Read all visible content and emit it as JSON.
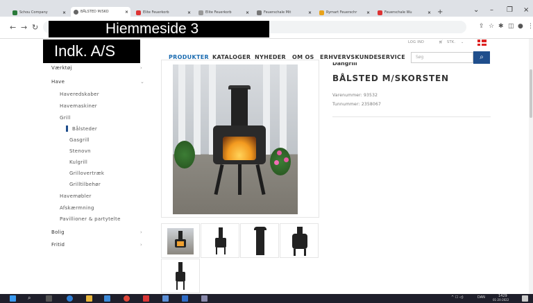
{
  "browser": {
    "tabs": [
      {
        "title": "Schou Company",
        "color": "#2a7a3a",
        "active": false
      },
      {
        "title": "BÅLSTED M/SKO",
        "color": "#666",
        "active": true
      },
      {
        "title": "Elite Feuerkorb",
        "color": "#d33",
        "active": false
      },
      {
        "title": "Elite Feuerkorb",
        "color": "#999",
        "active": false
      },
      {
        "title": "Feuerschale Mit",
        "color": "#777",
        "active": false
      },
      {
        "title": "Rymart Feuerschr",
        "color": "#e8a21a",
        "active": false
      },
      {
        "title": "Feuerschale Wu",
        "color": "#d33",
        "active": false
      }
    ],
    "url_redacted_text": "Hiemmeside 3",
    "nav": {
      "back": "←",
      "forward": "→",
      "reload": "↻"
    }
  },
  "site": {
    "logo_redacted_text": "Indk. A/S",
    "top_links": {
      "login": "LOG IND",
      "cart": "STK."
    },
    "nav": [
      {
        "label": "PRODUKTER",
        "active": true
      },
      {
        "label": "KATALOGER",
        "active": false
      },
      {
        "label": "NYHEDER",
        "active": false
      },
      {
        "label": "OM OS",
        "active": false
      },
      {
        "label": "ERHVERVSKUNDE",
        "active": false
      },
      {
        "label": "SERVICE",
        "active": false
      }
    ],
    "search_placeholder": "Søg"
  },
  "sidebar": {
    "items": [
      {
        "label": "Værktøj",
        "level": 0,
        "chev": "›"
      },
      {
        "label": "Have",
        "level": 0,
        "chev": "⌄"
      },
      {
        "label": "Haveredskaber",
        "level": 1
      },
      {
        "label": "Havemaskiner",
        "level": 1
      },
      {
        "label": "Grill",
        "level": 1
      },
      {
        "label": "Bålsteder",
        "level": 2,
        "selected": true
      },
      {
        "label": "Gasgrill",
        "level": 2
      },
      {
        "label": "Stenovn",
        "level": 2
      },
      {
        "label": "Kulgrill",
        "level": 2
      },
      {
        "label": "Grillovertræk",
        "level": 2
      },
      {
        "label": "Grilltilbehør",
        "level": 2
      },
      {
        "label": "Havemøbler",
        "level": 1
      },
      {
        "label": "Afskærmning",
        "level": 1
      },
      {
        "label": "Pavillioner & partytelte",
        "level": 1
      },
      {
        "label": "Bolig",
        "level": 0,
        "chev": "›"
      },
      {
        "label": "Fritid",
        "level": 0,
        "chev": "›"
      }
    ]
  },
  "product": {
    "brand_cut": "Dangrill",
    "title": "BÅLSTED M/SKORSTEN",
    "varenummer": "Varenummer: 93532",
    "tunnummer": "Tunnummer: 2358067"
  },
  "taskbar": {
    "clock_time": "1429",
    "clock_date": "01-20-2022",
    "lang": "DAN"
  }
}
